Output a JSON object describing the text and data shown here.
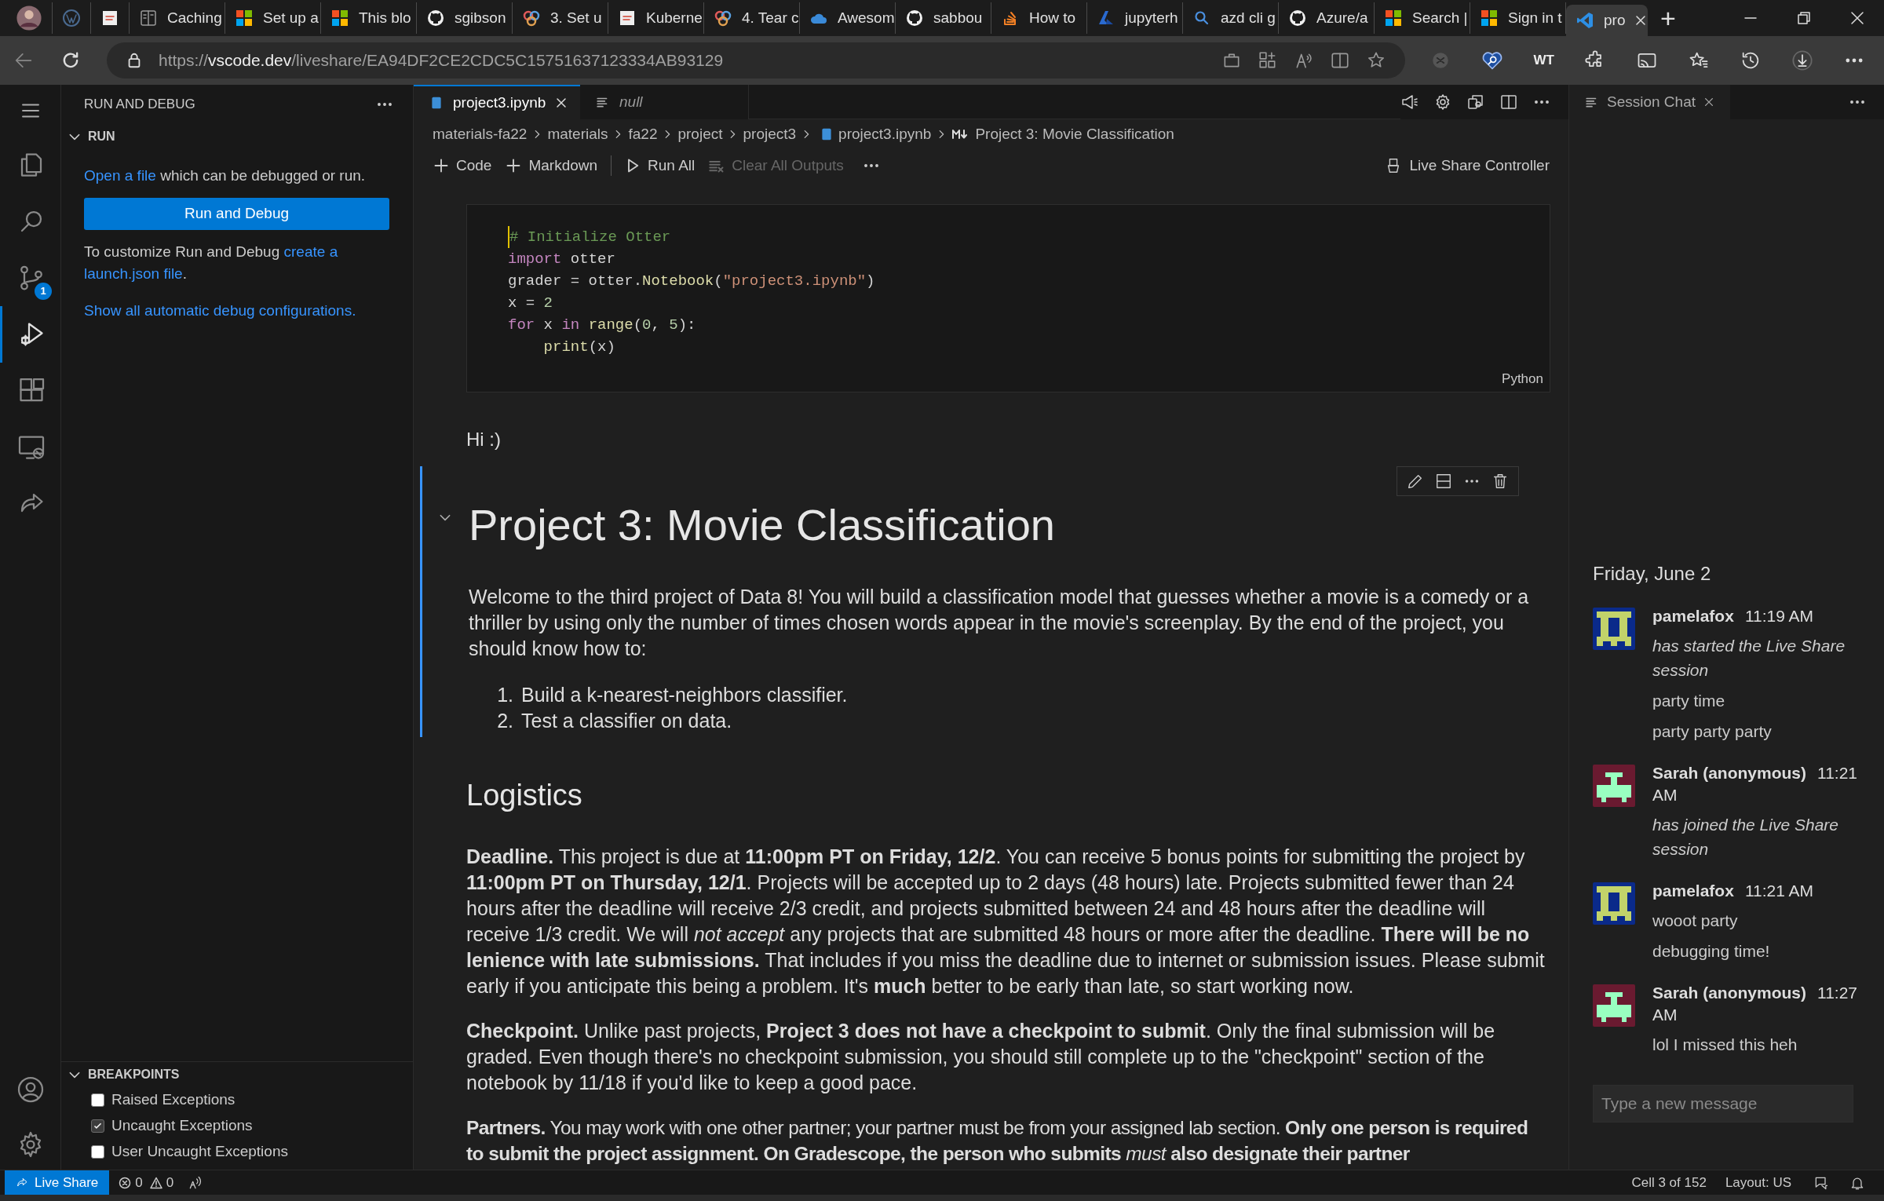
{
  "browser": {
    "tabs": [
      {
        "selected": false
      },
      {
        "selected": false
      },
      {
        "selected": false
      },
      {
        "label": "Caching",
        "selected": false
      },
      {
        "label": "Set up a",
        "selected": false
      },
      {
        "label": "This blo",
        "selected": false
      },
      {
        "label": "sgibson",
        "selected": false
      },
      {
        "label": "3. Set u",
        "selected": false
      },
      {
        "label": "Kuberne",
        "selected": false
      },
      {
        "label": "4. Tear c",
        "selected": false
      },
      {
        "label": "Awesom",
        "selected": false
      },
      {
        "label": "sabbou",
        "selected": false
      },
      {
        "label": "How to",
        "selected": false
      },
      {
        "label": "jupyterh",
        "selected": false
      },
      {
        "label": "azd cli g",
        "selected": false
      },
      {
        "label": "Azure/a",
        "selected": false
      },
      {
        "label": "Search |",
        "selected": false
      },
      {
        "label": "Sign in t",
        "selected": false
      },
      {
        "label": "pro",
        "selected": true
      }
    ],
    "new_tab": "+",
    "url_prefix": "https://",
    "url_host": "vscode.dev",
    "url_path": "/liveshare/EA94DF2CE2CDC5C15751637123334AB93129",
    "toolbar_badge": "WT"
  },
  "activity_bar": {
    "items": [
      {
        "selected": false
      },
      {
        "selected": false
      },
      {
        "selected": false,
        "badge": "1"
      },
      {
        "selected": true
      },
      {
        "selected": false
      },
      {
        "selected": false
      },
      {
        "selected": false
      }
    ]
  },
  "sidebar": {
    "title": "RUN AND DEBUG",
    "section": "RUN",
    "open_link": "Open a file",
    "open_text": "which can be debugged or run.",
    "run_button": "Run and Debug",
    "customize_text": "To customize Run and Debug",
    "customize_link": [
      "create a",
      "launch.json file"
    ],
    "customize_end": ".",
    "show_all": "Show all automatic debug configurations.",
    "breakpoints": {
      "title": "BREAKPOINTS",
      "items": [
        {
          "label": "Raised Exceptions",
          "checked": false
        },
        {
          "label": "Uncaught Exceptions",
          "checked": true
        },
        {
          "label": "User Uncaught Exceptions",
          "checked": false
        }
      ]
    }
  },
  "editor": {
    "tabs": [
      {
        "label": "project3.ipynb",
        "selected": true
      },
      {
        "label": "null",
        "selected": false
      }
    ],
    "breadcrumbs": [
      "materials-fa22",
      "materials",
      "fa22",
      "project",
      "project3",
      "project3.ipynb",
      "Project 3: Movie Classification"
    ],
    "toolbar": [
      {
        "label": "Code",
        "kind": "add",
        "disabled": false
      },
      {
        "label": "Markdown",
        "kind": "add",
        "disabled": false
      },
      {
        "label": "Run All",
        "kind": "run",
        "disabled": false
      },
      {
        "label": "Clear All Outputs",
        "kind": "clear",
        "disabled": true
      }
    ],
    "controller": "Live Share Controller",
    "code_cell": {
      "language": "Python",
      "lines": [
        [
          {
            "t": "# Initialize Otter",
            "kind": "comment"
          }
        ],
        [
          {
            "t": "import",
            "kind": "keyword"
          },
          {
            "t": " otter",
            "kind": "plain"
          }
        ],
        [
          {
            "t": "grader = otter.",
            "kind": "plain"
          },
          {
            "t": "Notebook",
            "kind": "func"
          },
          {
            "t": "(",
            "kind": "plain"
          },
          {
            "t": "\"project3.ipynb\"",
            "kind": "string"
          },
          {
            "t": ")",
            "kind": "plain"
          }
        ],
        [
          {
            "t": "x = ",
            "kind": "plain"
          },
          {
            "t": "2",
            "kind": "number"
          }
        ],
        [
          {
            "t": "for",
            "kind": "keyword"
          },
          {
            "t": " x ",
            "kind": "plain"
          },
          {
            "t": "in",
            "kind": "keyword"
          },
          {
            "t": " range",
            "kind": "func"
          },
          {
            "t": "(",
            "kind": "plain"
          },
          {
            "t": "0",
            "kind": "number"
          },
          {
            "t": ", ",
            "kind": "plain"
          },
          {
            "t": "5",
            "kind": "number"
          },
          {
            "t": "):",
            "kind": "plain"
          }
        ],
        [
          {
            "t": "    print",
            "kind": "func"
          },
          {
            "t": "(x)",
            "kind": "plain"
          }
        ]
      ]
    },
    "markdown_small": "Hi :)",
    "markdown_cell": {
      "selected": true,
      "heading": "Project 3: Movie Classification",
      "intro": "Welcome to the third project of Data 8! You will build a classification model that guesses whether a movie is a comedy or a thriller by using only the number of times chosen words appear in the movie's screenplay. By the end of the project, you should know how to:",
      "list": [
        {
          "num": "1.",
          "text": "Build a k-nearest-neighbors classifier."
        },
        {
          "num": "2.",
          "text": "Test a classifier on data."
        }
      ]
    },
    "logistics": {
      "heading": "Logistics",
      "paragraphs": [
        "**Deadline.** This project is due at **11:00pm PT on Friday, 12/2**. You can receive 5 bonus points for submitting the project by **11:00pm PT on Thursday, 12/1**. Projects will be accepted up to 2 days (48 hours) late. Projects submitted fewer than 24 hours after the deadline will receive 2/3 credit, and projects submitted between 24 and 48 hours after the deadline will receive 1/3 credit. We will *not accept* any projects that are submitted 48 hours or more after the deadline. **There will be no lenience with late submissions.** That includes if you miss the deadline due to internet or submission issues. Please submit early if you anticipate this being a problem. It's **much** better to be early than late, so start working now.",
        "**Checkpoint.** Unlike past projects, **Project 3 does not have a checkpoint to submit**. Only the final submission will be graded. Even though there's no checkpoint submission, you should still complete up to the \"checkpoint\" section of the notebook by 11/18 if you'd like to keep a good pace.",
        "**Partners.** You may work with one other partner; your partner must be from your assigned lab section. **Only one person is required to submit the project assignment. On Gradescope, the person who submits** *must* **also designate their partner**"
      ]
    }
  },
  "chat": {
    "tab": "Session Chat",
    "date": "Friday, June 2",
    "messages": [
      {
        "author": "pamelafox",
        "color": "#0a2a8a",
        "time": "11:19 AM",
        "lines": [
          {
            "text": "has started the Live Share session",
            "kind": "event"
          },
          {
            "text": "party time",
            "kind": "text"
          },
          {
            "text": "party party party",
            "kind": "text"
          }
        ]
      },
      {
        "author": "Sarah (anonymous)",
        "color": "#6a1a30",
        "time": "11:21 AM",
        "lines": [
          {
            "text": "has joined the Live Share session",
            "kind": "event"
          }
        ]
      },
      {
        "author": "pamelafox",
        "color": "#0a2a8a",
        "time": "11:21 AM",
        "lines": [
          {
            "text": "wooot party",
            "kind": "text"
          },
          {
            "text": "debugging time!",
            "kind": "text"
          }
        ]
      },
      {
        "author": "Sarah (anonymous)",
        "color": "#6a1a30",
        "time": "11:27 AM",
        "lines": [
          {
            "text": "lol I missed this heh",
            "kind": "text"
          }
        ]
      }
    ],
    "placeholder": "Type a new message"
  },
  "status_bar": {
    "live_share": "Live Share",
    "errors": "0",
    "warnings": "0",
    "cell": "Cell 3 of 152",
    "layout": "Layout: US"
  }
}
